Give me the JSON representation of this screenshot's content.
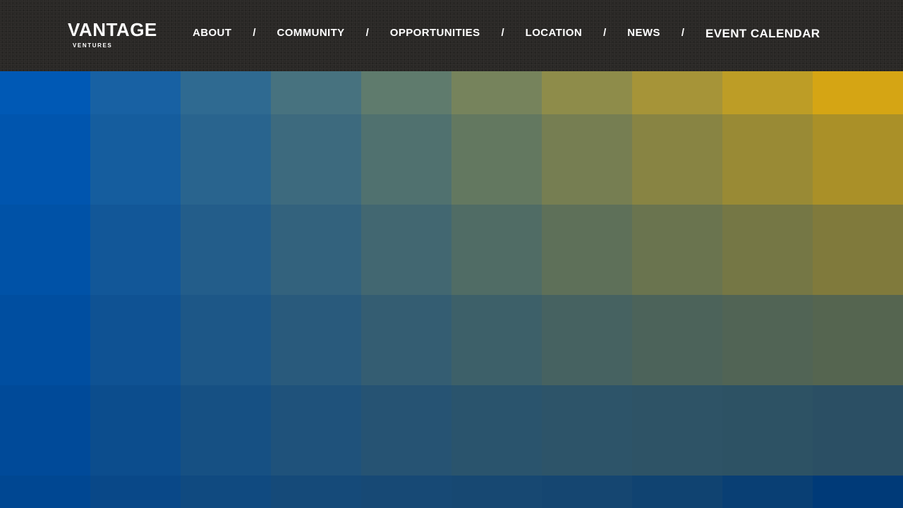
{
  "header": {
    "logo": {
      "wordmark": "VANTAGE",
      "subtext": "VENTURES"
    },
    "nav": {
      "items": [
        {
          "label": "ABOUT"
        },
        {
          "label": "COMMUNITY"
        },
        {
          "label": "OPPORTUNITIES"
        },
        {
          "label": "LOCATION"
        },
        {
          "label": "NEWS"
        }
      ],
      "separator": "/",
      "event_label": "EVENT CALENDAR"
    }
  },
  "hero": {
    "gradient_start": "#0059b5",
    "gradient_end": "#d5a514",
    "gradient_bottom": "#003a78",
    "columns": 10,
    "rows": 6
  },
  "colors": {
    "header_bg": "#2a2826",
    "nav_text": "#ffffff"
  }
}
